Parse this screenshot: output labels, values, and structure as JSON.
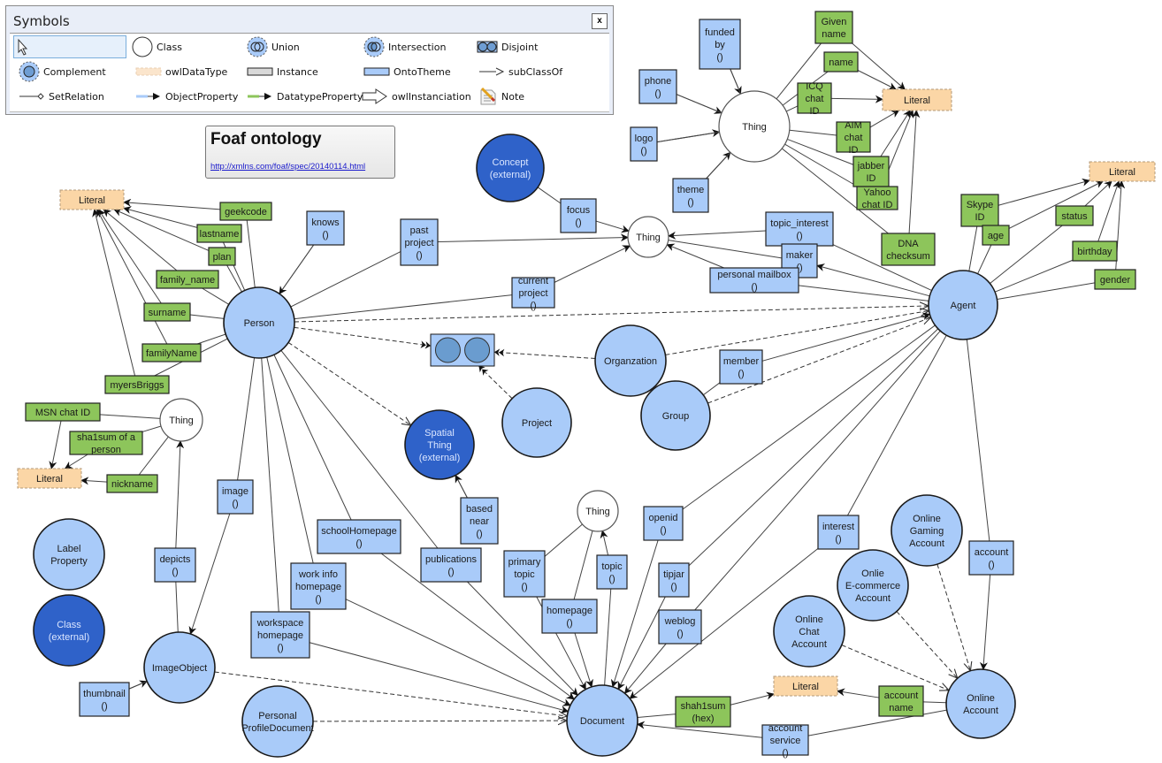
{
  "palette": {
    "title": "Symbols",
    "close_label": "x",
    "items": [
      {
        "id": "pointer",
        "label": ""
      },
      {
        "id": "class",
        "label": "Class"
      },
      {
        "id": "union",
        "label": "Union"
      },
      {
        "id": "intersection",
        "label": "Intersection"
      },
      {
        "id": "disjoint",
        "label": "Disjoint"
      },
      {
        "id": "complement",
        "label": "Complement"
      },
      {
        "id": "owldatatype",
        "label": "owlDataType"
      },
      {
        "id": "instance",
        "label": "Instance"
      },
      {
        "id": "ontotheme",
        "label": "OntoTheme"
      },
      {
        "id": "subclassof",
        "label": "subClassOf"
      },
      {
        "id": "setrelation",
        "label": "SetRelation"
      },
      {
        "id": "objectproperty",
        "label": "ObjectProperty"
      },
      {
        "id": "datatypeproperty",
        "label": "DatatypeProperty"
      },
      {
        "id": "owlinstanciation",
        "label": "owlInstanciation"
      },
      {
        "id": "note",
        "label": "Note"
      }
    ]
  },
  "title_note": {
    "title": "Foaf ontology",
    "link": "http://xmlns.com/foaf/spec/20140114.html"
  },
  "colors": {
    "class_fill": "#a9cbf9",
    "external_fill": "#2f62c9",
    "thing_fill": "#ffffff",
    "object_prop_fill": "#a9cbf9",
    "datatype_prop_fill": "#8dc55b",
    "literal_fill": "#fbd6a6",
    "stroke": "#1a1a1a"
  },
  "nodes": [
    {
      "id": "thing_top",
      "type": "thing",
      "label": [
        "Thing"
      ]
    },
    {
      "id": "lit_top",
      "type": "literal",
      "label": [
        "Literal"
      ]
    },
    {
      "id": "concept",
      "type": "external",
      "label": [
        "Concept",
        "(external)"
      ]
    },
    {
      "id": "thing_mid",
      "type": "thing",
      "label": [
        "Thing"
      ]
    },
    {
      "id": "lit_right",
      "type": "literal",
      "label": [
        "Literal"
      ]
    },
    {
      "id": "lit_left",
      "type": "literal",
      "label": [
        "Literal"
      ]
    },
    {
      "id": "person",
      "type": "class",
      "label": [
        "Person"
      ]
    },
    {
      "id": "agent",
      "type": "class",
      "label": [
        "Agent"
      ]
    },
    {
      "id": "disjoint",
      "type": "disjoint",
      "label": []
    },
    {
      "id": "organization",
      "type": "class",
      "label": [
        "Organzation"
      ]
    },
    {
      "id": "project",
      "type": "class",
      "label": [
        "Project"
      ]
    },
    {
      "id": "group",
      "type": "class",
      "label": [
        "Group"
      ]
    },
    {
      "id": "spatial",
      "type": "external",
      "label": [
        "Spatial",
        "Thing",
        "(external)"
      ]
    },
    {
      "id": "thing_left",
      "type": "thing",
      "label": [
        "Thing"
      ]
    },
    {
      "id": "lit_left2",
      "type": "literal",
      "label": [
        "Literal"
      ]
    },
    {
      "id": "label_prop",
      "type": "class",
      "label": [
        "Label",
        "Property"
      ]
    },
    {
      "id": "class_ext",
      "type": "external",
      "label": [
        "Class",
        "(external)"
      ]
    },
    {
      "id": "image_object",
      "type": "class",
      "label": [
        "ImageObject"
      ]
    },
    {
      "id": "ppd",
      "type": "class",
      "label": [
        "Personal",
        "ProfileDocument"
      ]
    },
    {
      "id": "thing_doc",
      "type": "thing",
      "label": [
        "Thing"
      ]
    },
    {
      "id": "document",
      "type": "class",
      "label": [
        "Document"
      ]
    },
    {
      "id": "gaming",
      "type": "class",
      "label": [
        "Online",
        "Gaming",
        "Account"
      ]
    },
    {
      "id": "ecommerce",
      "type": "class",
      "label": [
        "Onlie",
        "E-commerce",
        "Account"
      ]
    },
    {
      "id": "chat",
      "type": "class",
      "label": [
        "Online",
        "Chat",
        "Account"
      ]
    },
    {
      "id": "online_account",
      "type": "class",
      "label": [
        "Online",
        "Account"
      ]
    },
    {
      "id": "lit_bottom",
      "type": "literal",
      "label": [
        "Literal"
      ]
    }
  ],
  "properties": [
    {
      "id": "funded_by",
      "kind": "object",
      "label": [
        "funded",
        "by",
        "()"
      ]
    },
    {
      "id": "phone",
      "kind": "object",
      "label": [
        "phone",
        "()"
      ]
    },
    {
      "id": "logo",
      "kind": "object",
      "label": [
        "logo",
        "()"
      ]
    },
    {
      "id": "theme",
      "kind": "object",
      "label": [
        "theme",
        "()"
      ]
    },
    {
      "id": "given_name",
      "kind": "datatype",
      "label": [
        "Given",
        "name"
      ]
    },
    {
      "id": "name",
      "kind": "datatype",
      "label": [
        "name"
      ]
    },
    {
      "id": "icq",
      "kind": "datatype",
      "label": [
        "ICQ",
        "chat",
        "ID"
      ]
    },
    {
      "id": "aim",
      "kind": "datatype",
      "label": [
        "AIM",
        "chat",
        "ID"
      ]
    },
    {
      "id": "jabber",
      "kind": "datatype",
      "label": [
        "jabber",
        "ID"
      ]
    },
    {
      "id": "yahoo",
      "kind": "datatype",
      "label": [
        "Yahoo",
        "chat ID"
      ]
    },
    {
      "id": "dna",
      "kind": "datatype",
      "label": [
        "DNA",
        "checksum"
      ]
    },
    {
      "id": "focus",
      "kind": "object",
      "label": [
        "focus",
        "()"
      ]
    },
    {
      "id": "past_project",
      "kind": "object",
      "label": [
        "past",
        "project",
        "()"
      ]
    },
    {
      "id": "current_project",
      "kind": "object",
      "label": [
        "current",
        "project",
        "()"
      ]
    },
    {
      "id": "topic_interest",
      "kind": "object",
      "label": [
        "topic_interest",
        "()"
      ]
    },
    {
      "id": "maker",
      "kind": "object",
      "label": [
        "maker",
        "()"
      ]
    },
    {
      "id": "mailbox",
      "kind": "object",
      "label": [
        "personal mailbox",
        "()"
      ]
    },
    {
      "id": "skype",
      "kind": "datatype",
      "label": [
        "Skype",
        "ID"
      ]
    },
    {
      "id": "age",
      "kind": "datatype",
      "label": [
        "age"
      ]
    },
    {
      "id": "status",
      "kind": "datatype",
      "label": [
        "status"
      ]
    },
    {
      "id": "birthday",
      "kind": "datatype",
      "label": [
        "birthday"
      ]
    },
    {
      "id": "gender",
      "kind": "datatype",
      "label": [
        "gender"
      ]
    },
    {
      "id": "geekcode",
      "kind": "datatype",
      "label": [
        "geekcode"
      ]
    },
    {
      "id": "lastname",
      "kind": "datatype",
      "label": [
        "lastname"
      ]
    },
    {
      "id": "plan",
      "kind": "datatype",
      "label": [
        "plan"
      ]
    },
    {
      "id": "family_name",
      "kind": "datatype",
      "label": [
        "family_name"
      ]
    },
    {
      "id": "surname",
      "kind": "datatype",
      "label": [
        "surname"
      ]
    },
    {
      "id": "familyName",
      "kind": "datatype",
      "label": [
        "familyName"
      ]
    },
    {
      "id": "myersBriggs",
      "kind": "datatype",
      "label": [
        "myersBriggs"
      ]
    },
    {
      "id": "knows",
      "kind": "object",
      "label": [
        "knows",
        "()"
      ]
    },
    {
      "id": "member",
      "kind": "object",
      "label": [
        "member",
        "()"
      ]
    },
    {
      "id": "msn",
      "kind": "datatype",
      "label": [
        "MSN chat ID"
      ]
    },
    {
      "id": "sha1sum_person",
      "kind": "datatype",
      "label": [
        "sha1sum of a",
        "person"
      ]
    },
    {
      "id": "nickname",
      "kind": "datatype",
      "label": [
        "nickname"
      ]
    },
    {
      "id": "image",
      "kind": "object",
      "label": [
        "image",
        "()"
      ]
    },
    {
      "id": "depicts",
      "kind": "object",
      "label": [
        "depicts",
        "()"
      ]
    },
    {
      "id": "thumbnail",
      "kind": "object",
      "label": [
        "thumbnail",
        "()"
      ]
    },
    {
      "id": "based_near",
      "kind": "object",
      "label": [
        "based",
        "near",
        "()"
      ]
    },
    {
      "id": "school_homepage",
      "kind": "object",
      "label": [
        "schoolHomepage",
        "()"
      ]
    },
    {
      "id": "work_info",
      "kind": "object",
      "label": [
        "work info",
        "homepage",
        "()"
      ]
    },
    {
      "id": "workspace",
      "kind": "object",
      "label": [
        "workspace",
        "homepage",
        "()"
      ]
    },
    {
      "id": "publications",
      "kind": "object",
      "label": [
        "publications",
        "()"
      ]
    },
    {
      "id": "primary_topic",
      "kind": "object",
      "label": [
        "primary",
        "topic",
        "()"
      ]
    },
    {
      "id": "homepage",
      "kind": "object",
      "label": [
        "homepage",
        "()"
      ]
    },
    {
      "id": "topic",
      "kind": "object",
      "label": [
        "topic",
        "()"
      ]
    },
    {
      "id": "openid",
      "kind": "object",
      "label": [
        "openid",
        "()"
      ]
    },
    {
      "id": "tipjar",
      "kind": "object",
      "label": [
        "tipjar",
        "()"
      ]
    },
    {
      "id": "weblog",
      "kind": "object",
      "label": [
        "weblog",
        "()"
      ]
    },
    {
      "id": "interest",
      "kind": "object",
      "label": [
        "interest",
        "()"
      ]
    },
    {
      "id": "account",
      "kind": "object",
      "label": [
        "account",
        "()"
      ]
    },
    {
      "id": "shah1sum",
      "kind": "datatype",
      "label": [
        "shah1sum",
        "(hex)"
      ]
    },
    {
      "id": "account_name",
      "kind": "datatype",
      "label": [
        "account",
        "name"
      ]
    },
    {
      "id": "account_service",
      "kind": "object",
      "label": [
        "account",
        "service",
        "()"
      ]
    }
  ]
}
